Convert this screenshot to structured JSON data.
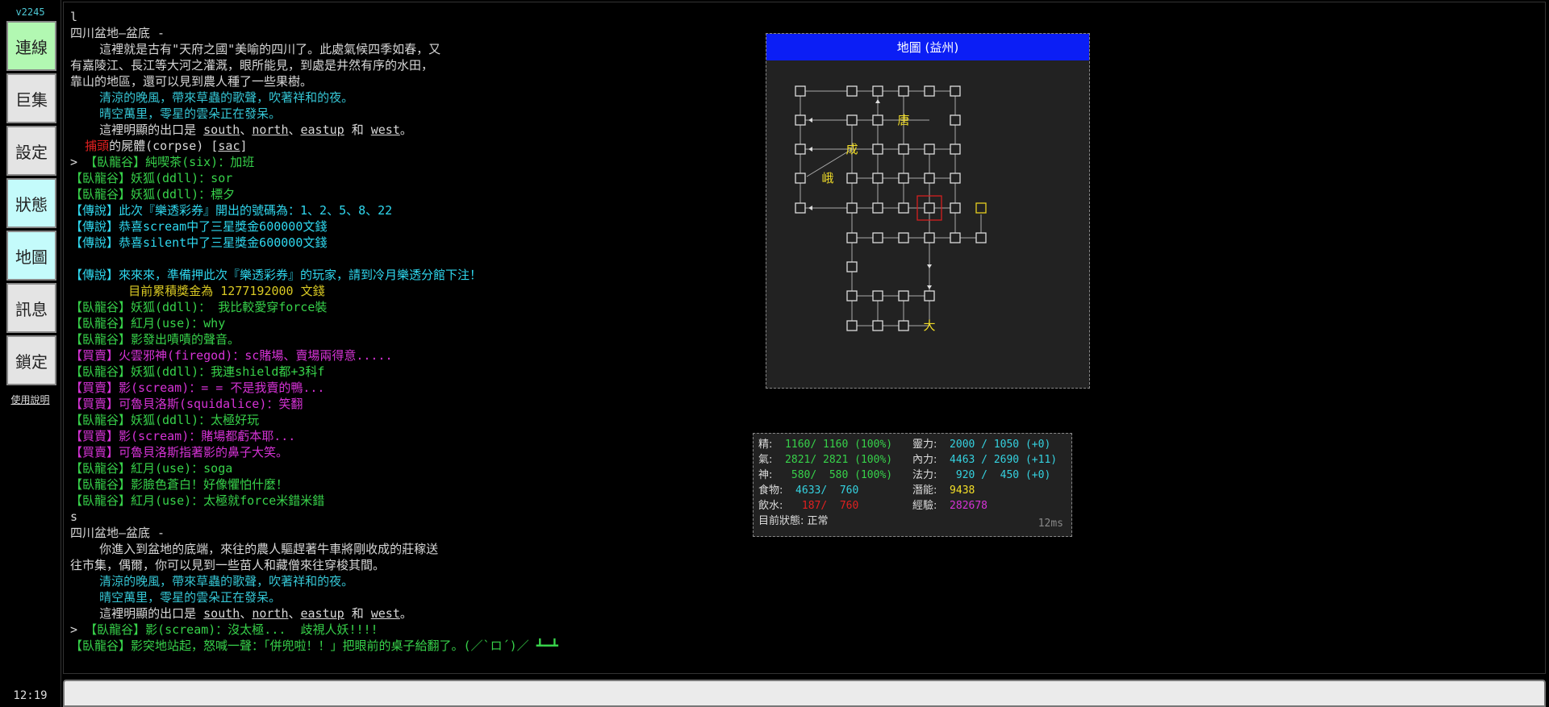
{
  "sidebar": {
    "version": "v2245",
    "buttons": [
      {
        "label": "連線",
        "color": "#b2f8b2"
      },
      {
        "label": "巨集",
        "color": "#e4e4e4"
      },
      {
        "label": "設定",
        "color": "#e4e4e4"
      },
      {
        "label": "狀態",
        "color": "#c4fbfb"
      },
      {
        "label": "地圖",
        "color": "#c4fbfb"
      },
      {
        "label": "訊息",
        "color": "#e4e4e4"
      },
      {
        "label": "鎖定",
        "color": "#e4e4e4"
      }
    ],
    "help_link": "使用說明",
    "clock": "12:19"
  },
  "output_lines": [
    [
      {
        "t": "l",
        "c": "white"
      }
    ],
    [
      {
        "t": "四川盆地—盆底 -",
        "c": "white"
      }
    ],
    [
      {
        "t": "    這裡就是古有\"天府之國\"美喻的四川了。此處氣候四季如春，又",
        "c": "white"
      }
    ],
    [
      {
        "t": "有嘉陵江、長江等大河之灌溉，眼所能見，到處是井然有序的水田，",
        "c": "white"
      }
    ],
    [
      {
        "t": "靠山的地區，還可以見到農人種了一些果樹。",
        "c": "white"
      }
    ],
    [
      {
        "t": "    清涼的晚風，帶來草蟲的歌聲，吹著祥和的夜。",
        "c": "cyan"
      }
    ],
    [
      {
        "t": "    晴空萬里，零星的雲朵正在發呆。",
        "c": "cyan"
      }
    ],
    [
      {
        "t": "    這裡明顯的出口是 ",
        "c": "white"
      },
      {
        "t": "south",
        "c": "white",
        "u": true
      },
      {
        "t": "、",
        "c": "white"
      },
      {
        "t": "north",
        "c": "white",
        "u": true
      },
      {
        "t": "、",
        "c": "white"
      },
      {
        "t": "eastup",
        "c": "white",
        "u": true
      },
      {
        "t": " 和 ",
        "c": "white"
      },
      {
        "t": "west",
        "c": "white",
        "u": true
      },
      {
        "t": "。",
        "c": "white"
      }
    ],
    [
      {
        "t": "  ",
        "c": "white"
      },
      {
        "t": "捕頭",
        "c": "red"
      },
      {
        "t": "的屍體(corpse) [",
        "c": "white"
      },
      {
        "t": "sac",
        "c": "white",
        "u": true
      },
      {
        "t": "]",
        "c": "white"
      }
    ],
    [
      {
        "t": "> ",
        "c": "white"
      },
      {
        "t": "【臥龍谷】純喫茶(six)：加班",
        "c": "green"
      }
    ],
    [
      {
        "t": "【臥龍谷】妖狐(ddll)：sor",
        "c": "green"
      }
    ],
    [
      {
        "t": "【臥龍谷】妖狐(ddll)：標夕",
        "c": "green"
      }
    ],
    [
      {
        "t": "【傳說】此次『樂透彩券』開出的號碼為：1、2、5、8、22",
        "c": "bcyan"
      }
    ],
    [
      {
        "t": "【傳說】恭喜scream中了三星獎金600000文錢",
        "c": "bcyan"
      }
    ],
    [
      {
        "t": "【傳說】恭喜silent中了三星獎金600000文錢",
        "c": "bcyan"
      }
    ],
    [],
    [
      {
        "t": "【傳說】來來來，準備押此次『樂透彩券』的玩家，請到冷月樂透分館下注！",
        "c": "bcyan"
      }
    ],
    [
      {
        "t": "        目前累積獎金為 1277192000 文錢",
        "c": "yel"
      }
    ],
    [
      {
        "t": "【臥龍谷】妖狐(ddll)： 我比較愛穿force裝",
        "c": "green"
      }
    ],
    [
      {
        "t": "【臥龍谷】紅月(use)：why",
        "c": "green"
      }
    ],
    [
      {
        "t": "【臥龍谷】影發出嘖嘖的聲音。",
        "c": "green"
      }
    ],
    [
      {
        "t": "【買賣】火雲邪神(firegod)：sc賭場、賣場兩得意.....",
        "c": "mag"
      }
    ],
    [
      {
        "t": "【臥龍谷】妖狐(ddll)：我連shield都+3科f",
        "c": "green"
      }
    ],
    [
      {
        "t": "【買賣】影(scream)：= = 不是我賣的鴨...",
        "c": "mag"
      }
    ],
    [
      {
        "t": "【買賣】可魯貝洛斯(squidalice)：笑翻",
        "c": "mag"
      }
    ],
    [
      {
        "t": "【臥龍谷】妖狐(ddll)：太極好玩",
        "c": "green"
      }
    ],
    [
      {
        "t": "【買賣】影(scream)：賭場都虧本耶...",
        "c": "mag"
      }
    ],
    [
      {
        "t": "【買賣】可魯貝洛斯指著影的鼻子大笑。",
        "c": "mag"
      }
    ],
    [
      {
        "t": "【臥龍谷】紅月(use)：soga",
        "c": "green"
      }
    ],
    [
      {
        "t": "【臥龍谷】影臉色蒼白！好像懼怕什麼！",
        "c": "green"
      }
    ],
    [
      {
        "t": "【臥龍谷】紅月(use)：太極就force米錯米錯",
        "c": "green"
      }
    ],
    [
      {
        "t": "s",
        "c": "white"
      }
    ],
    [
      {
        "t": "四川盆地—盆底 -",
        "c": "white"
      }
    ],
    [
      {
        "t": "    你進入到盆地的底端，來往的農人驅趕著牛車將剛收成的莊稼送",
        "c": "white"
      }
    ],
    [
      {
        "t": "往市集，偶爾，你可以見到一些苗人和藏僧來往穿梭其間。",
        "c": "white"
      }
    ],
    [
      {
        "t": "    清涼的晚風，帶來草蟲的歌聲，吹著祥和的夜。",
        "c": "cyan"
      }
    ],
    [
      {
        "t": "    晴空萬里，零星的雲朵正在發呆。",
        "c": "cyan"
      }
    ],
    [
      {
        "t": "    這裡明顯的出口是 ",
        "c": "white"
      },
      {
        "t": "south",
        "c": "white",
        "u": true
      },
      {
        "t": "、",
        "c": "white"
      },
      {
        "t": "north",
        "c": "white",
        "u": true
      },
      {
        "t": "、",
        "c": "white"
      },
      {
        "t": "eastup",
        "c": "white",
        "u": true
      },
      {
        "t": " 和 ",
        "c": "white"
      },
      {
        "t": "west",
        "c": "white",
        "u": true
      },
      {
        "t": "。",
        "c": "white"
      }
    ],
    [
      {
        "t": "> ",
        "c": "white"
      },
      {
        "t": "【臥龍谷】影(scream)：沒太極...  歧視人妖!!!!",
        "c": "green"
      }
    ],
    [
      {
        "t": "【臥龍谷】影突地站起，怒喊一聲：「併兜啦！！」把眼前的桌子給翻了。(／`ロ´)／ ┻━┻",
        "c": "green"
      }
    ]
  ],
  "map": {
    "title": "地圖 (益州)",
    "labels": [
      "唐",
      "成",
      "峨",
      "大"
    ]
  },
  "stats": {
    "rows": [
      [
        {
          "label": "精:",
          "value": "  1160/ 1160 (100%)",
          "color": "v-green"
        },
        {
          "label": "靈力:",
          "value": "  2000 / 1050 (+0)",
          "color": "v-cyan"
        }
      ],
      [
        {
          "label": "氣:",
          "value": "  2821/ 2821 (100%)",
          "color": "v-green"
        },
        {
          "label": "內力:",
          "value": "  4463 / 2690 (+11)",
          "color": "v-cyan"
        }
      ],
      [
        {
          "label": "神:",
          "value": "   580/  580 (100%)",
          "color": "v-green"
        },
        {
          "label": "法力:",
          "value": "   920 /  450 (+0)",
          "color": "v-cyan"
        }
      ],
      [
        {
          "label": "食物:",
          "value": "  4633/  760",
          "color": "v-cyan"
        },
        {
          "label": "潛能:",
          "value": "  9438",
          "color": "v-yel"
        }
      ],
      [
        {
          "label": "飲水:",
          "value": "   187/  760",
          "color": "v-red"
        },
        {
          "label": "經驗:",
          "value": "  282678",
          "color": "v-mag"
        }
      ],
      [
        {
          "label": "目前狀態:",
          "value": " 正常",
          "color": "slbl"
        },
        {
          "label": "",
          "value": "",
          "color": "slbl"
        }
      ]
    ],
    "latency": "12ms"
  },
  "input": {
    "value": ""
  }
}
